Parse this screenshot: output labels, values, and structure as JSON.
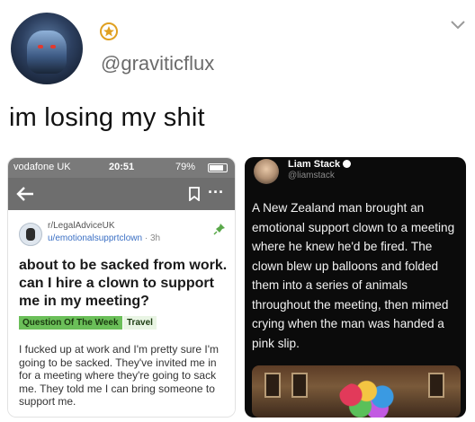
{
  "tweet": {
    "handle": "@graviticflux",
    "text": "im losing my shit"
  },
  "left_screenshot": {
    "status": {
      "carrier": "vodafone UK",
      "time": "20:51",
      "battery": "79%"
    },
    "post": {
      "subreddit": "r/LegalAdviceUK",
      "user": "u/emotionalsupprtclown",
      "age": "· 3h",
      "title": "about to be sacked from work. can I hire a clown to support me in my meeting?",
      "flair": "Question Of The Week",
      "flair2": "Travel",
      "body": "I fucked up at work and I'm pretty sure I'm going to be sacked. They've invited me in for a meeting where they're going to sack me. They told me I can bring someone to support me."
    }
  },
  "right_screenshot": {
    "name": "Liam Stack",
    "handle": "@liamstack",
    "text": "A New Zealand man brought an emotional support clown to a meeting where he knew he'd be fired. The clown blew up balloons and folded them into a series of animals throughout the meeting, then mimed crying when the man was handed a pink slip."
  },
  "colors": {
    "flair_green": "#6bbf59",
    "link_blue": "#3a6fc4",
    "dark_bg": "#0b0b0b"
  }
}
